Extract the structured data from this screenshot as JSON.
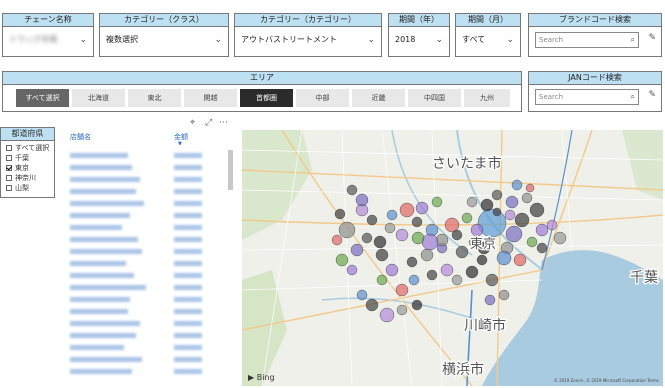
{
  "slicers": {
    "chain": {
      "header": "チェーン名称",
      "value": "ドラッグ市場"
    },
    "category_class": {
      "header": "カテゴリー（クラス）",
      "value": "複数選択"
    },
    "category_category": {
      "header": "カテゴリー（カテゴリー）",
      "value": "アウトバストリートメント"
    },
    "period_year": {
      "header": "期間（年）",
      "value": "2018"
    },
    "period_month": {
      "header": "期間（月）",
      "value": "すべて"
    },
    "brand_search": {
      "header": "ブランドコード検索",
      "placeholder": "Search"
    },
    "jan_search": {
      "header": "JANコード検索",
      "placeholder": "Search"
    }
  },
  "area": {
    "header": "エリア",
    "buttons": [
      "すべて選択",
      "北海道",
      "東北",
      "関越",
      "首都圏",
      "中部",
      "近畿",
      "中四国",
      "九州"
    ]
  },
  "prefecture": {
    "header": "都道府県",
    "items": [
      {
        "label": "すべて選択",
        "checked": false
      },
      {
        "label": "千葉",
        "checked": false
      },
      {
        "label": "東京",
        "checked": true
      },
      {
        "label": "神奈川",
        "checked": false
      },
      {
        "label": "山梨",
        "checked": false
      }
    ]
  },
  "table": {
    "col_store": "店舗名",
    "col_amount": "金額"
  },
  "map": {
    "labels": {
      "saitama": "さいたま市",
      "tokyo": "東京",
      "chiba": "千葉",
      "kawasaki": "川崎市",
      "yokohama": "横浜市"
    },
    "bing": "Bing",
    "copyright": "© 2019 Zenrin, © 2019 Microsoft Corporation Terms"
  },
  "icons": {
    "search": "search-icon",
    "eraser": "eraser-icon",
    "pin": "pin-icon",
    "focus": "focus-mode-icon",
    "more": "more-options-icon",
    "chevron": "chevron-down-icon"
  }
}
